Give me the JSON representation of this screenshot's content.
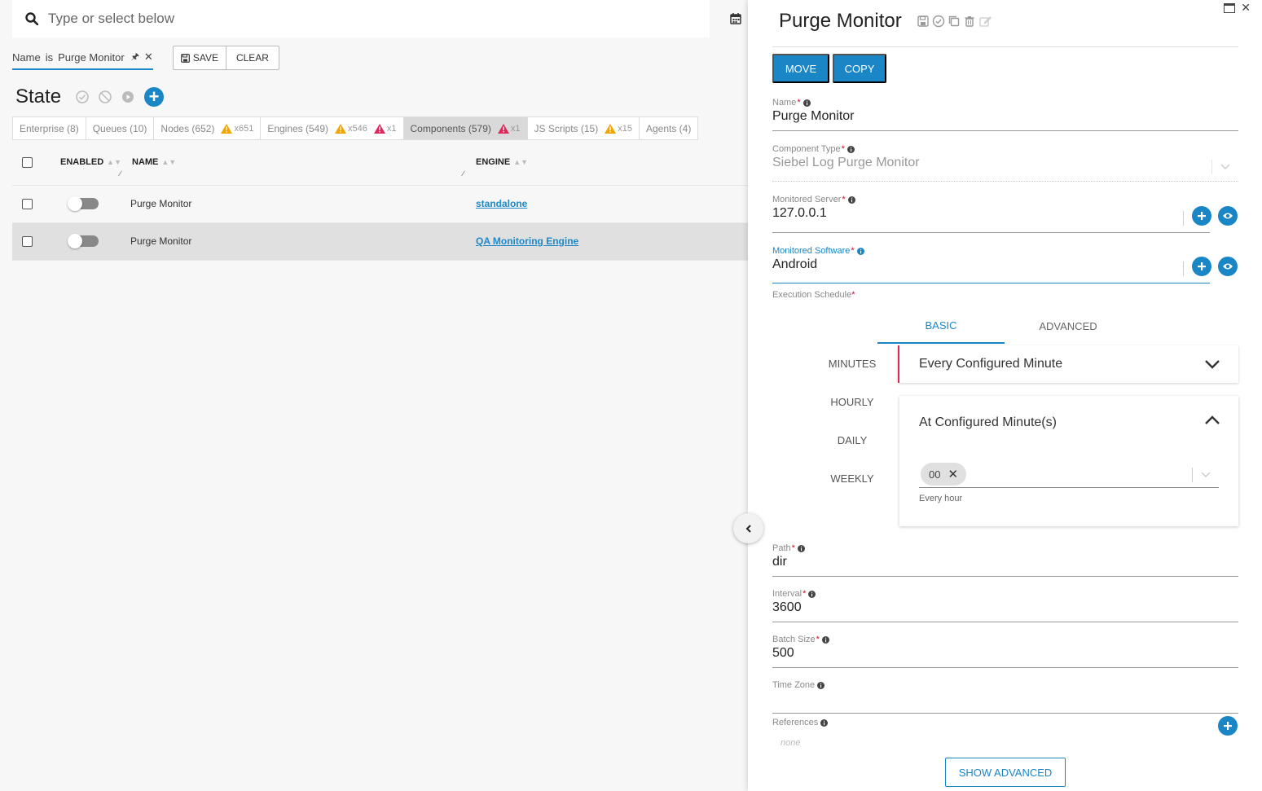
{
  "search": {
    "placeholder": "Type or select below"
  },
  "filter": {
    "field": "Name",
    "op": "is",
    "value": "Purge Monitor",
    "save_label": "SAVE",
    "clear_label": "CLEAR"
  },
  "state": {
    "title": "State"
  },
  "tabs": [
    {
      "label": "Enterprise (8)"
    },
    {
      "label": "Queues (10)"
    },
    {
      "label": "Nodes (652)",
      "warn": "x651"
    },
    {
      "label": "Engines (549)",
      "warn": "x546",
      "alert": "x1"
    },
    {
      "label": "Components (579)",
      "alert": "x1"
    },
    {
      "label": "JS Scripts (15)",
      "warn": "x15"
    },
    {
      "label": "Agents (4)"
    }
  ],
  "table": {
    "headers": {
      "enabled": "ENABLED",
      "name": "NAME",
      "engine": "ENGINE"
    },
    "rows": [
      {
        "name": "Purge Monitor",
        "engine": "standalone"
      },
      {
        "name": "Purge Monitor",
        "engine": "QA Monitoring Engine"
      }
    ]
  },
  "panel": {
    "title": "Purge Monitor",
    "move_label": "MOVE",
    "copy_label": "COPY",
    "fields": {
      "name": {
        "label": "Name",
        "value": "Purge Monitor"
      },
      "component_type": {
        "label": "Component Type",
        "value": "Siebel Log Purge Monitor"
      },
      "monitored_server": {
        "label": "Monitored Server",
        "value": "127.0.0.1"
      },
      "monitored_software": {
        "label": "Monitored Software",
        "value": "Android"
      },
      "path": {
        "label": "Path",
        "value": "dir"
      },
      "interval": {
        "label": "Interval",
        "value": "3600"
      },
      "batch_size": {
        "label": "Batch Size",
        "value": "500"
      },
      "time_zone": {
        "label": "Time Zone",
        "value": ""
      }
    },
    "schedule": {
      "label": "Execution Schedule",
      "tabs": {
        "basic": "BASIC",
        "advanced": "ADVANCED"
      },
      "side": {
        "minutes": "MINUTES",
        "hourly": "HOURLY",
        "daily": "DAILY",
        "weekly": "WEEKLY"
      },
      "mode": "Every Configured Minute",
      "card_title": "At Configured Minute(s)",
      "chip": "00",
      "hint": "Every hour"
    },
    "references": {
      "label": "References",
      "value": "none"
    },
    "show_advanced_label": "SHOW ADVANCED"
  },
  "colors": {
    "accent": "#1a86c6",
    "required": "#c8102e",
    "warn": "#f0a500",
    "alert": "#e2265a"
  }
}
